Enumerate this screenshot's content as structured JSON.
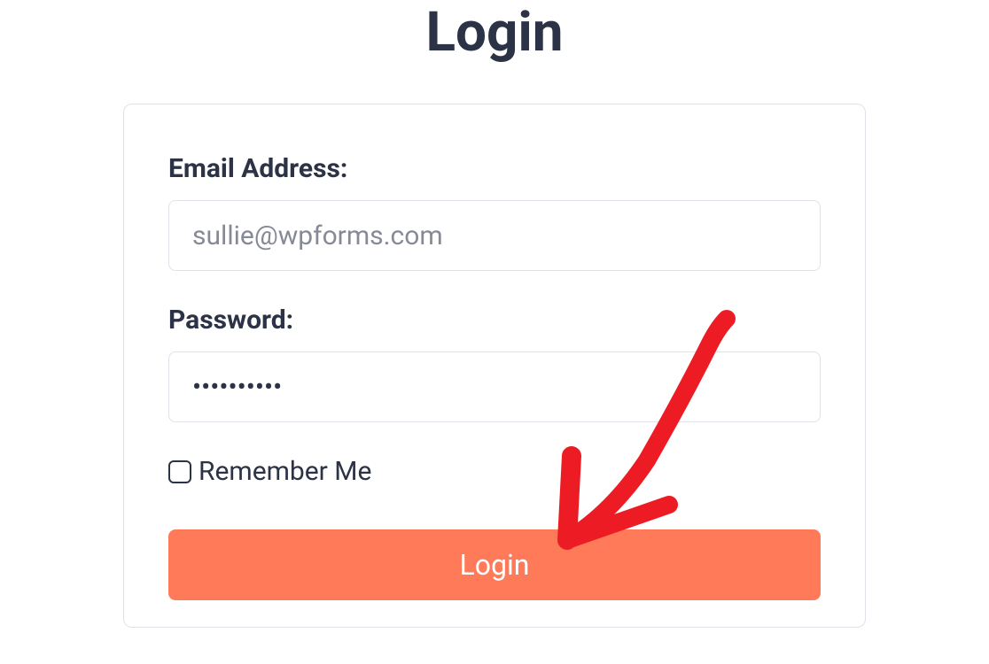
{
  "title": "Login",
  "form": {
    "email_label": "Email Address:",
    "email_placeholder": "sullie@wpforms.com",
    "password_label": "Password:",
    "password_value": "••••••••••",
    "remember_label": "Remember Me",
    "submit_label": "Login"
  },
  "colors": {
    "primary_button": "#ff7a59",
    "text_dark": "#2c3346",
    "border": "#dfe2e8",
    "annotation": "#ed1c24"
  }
}
